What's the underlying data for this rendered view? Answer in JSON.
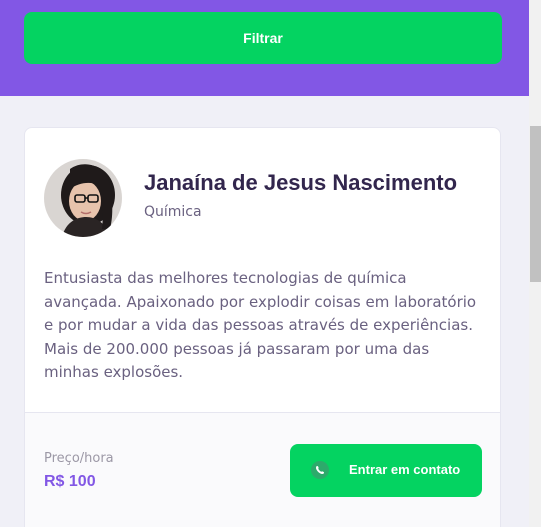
{
  "header": {
    "filter_label": "Filtrar"
  },
  "teacher": {
    "name": "Janaína de Jesus Nascimento",
    "subject": "Química",
    "bio": "Entusiasta das melhores tecnologias de química avançada. Apaixonado por explodir coisas em laboratório e por mudar a vida das pessoas através de experiências. Mais de 200.000 pessoas já passaram por uma das minhas explosões.",
    "price_label": "Preço/hora",
    "price_value": "R$ 100",
    "contact_label": "Entrar em contato",
    "avatar_icon": "teacher-photo"
  },
  "colors": {
    "primary": "#8257e5",
    "secondary": "#04d361",
    "title": "#32264d",
    "text": "#6a6180",
    "background": "#f0f0f7"
  }
}
